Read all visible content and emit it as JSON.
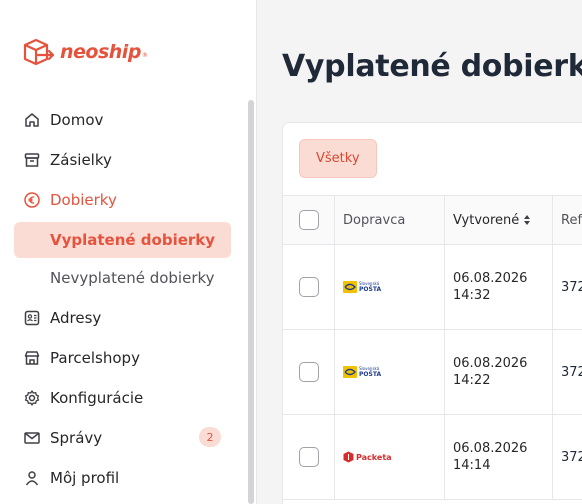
{
  "brand": {
    "name": "neoship",
    "reg": "®",
    "color": "#e5533d"
  },
  "sidebar": {
    "items": [
      {
        "label": "Domov",
        "icon": "home-icon"
      },
      {
        "label": "Zásielky",
        "icon": "box-icon"
      },
      {
        "label": "Dobierky",
        "icon": "euro-icon"
      },
      {
        "label": "Adresy",
        "icon": "address-book-icon"
      },
      {
        "label": "Parcelshopy",
        "icon": "store-icon"
      },
      {
        "label": "Konfigurácie",
        "icon": "gear-icon"
      },
      {
        "label": "Správy",
        "icon": "mail-icon",
        "badge": "2"
      },
      {
        "label": "Môj profil",
        "icon": "user-icon"
      }
    ],
    "sub_items": [
      {
        "label": "Vyplatené dobierky"
      },
      {
        "label": "Nevyplatené dobierky"
      }
    ]
  },
  "main": {
    "title": "Vyplatené dobierky",
    "filter_label": "Všetky",
    "columns": [
      "Dopravca",
      "Vytvorené",
      "Refe"
    ],
    "rows": [
      {
        "carrier": "Slovenská pošta",
        "carrier_short": "POŠTA",
        "carrier_top": "Slovenská",
        "date": "06.08.2026",
        "time": "14:32",
        "ref": "372"
      },
      {
        "carrier": "Slovenská pošta",
        "carrier_short": "POŠTA",
        "carrier_top": "Slovenská",
        "date": "06.08.2026",
        "time": "14:22",
        "ref": "372"
      },
      {
        "carrier": "Packeta",
        "carrier_short": "Packeta",
        "date": "06.08.2026",
        "time": "14:14",
        "ref": "372"
      }
    ]
  }
}
